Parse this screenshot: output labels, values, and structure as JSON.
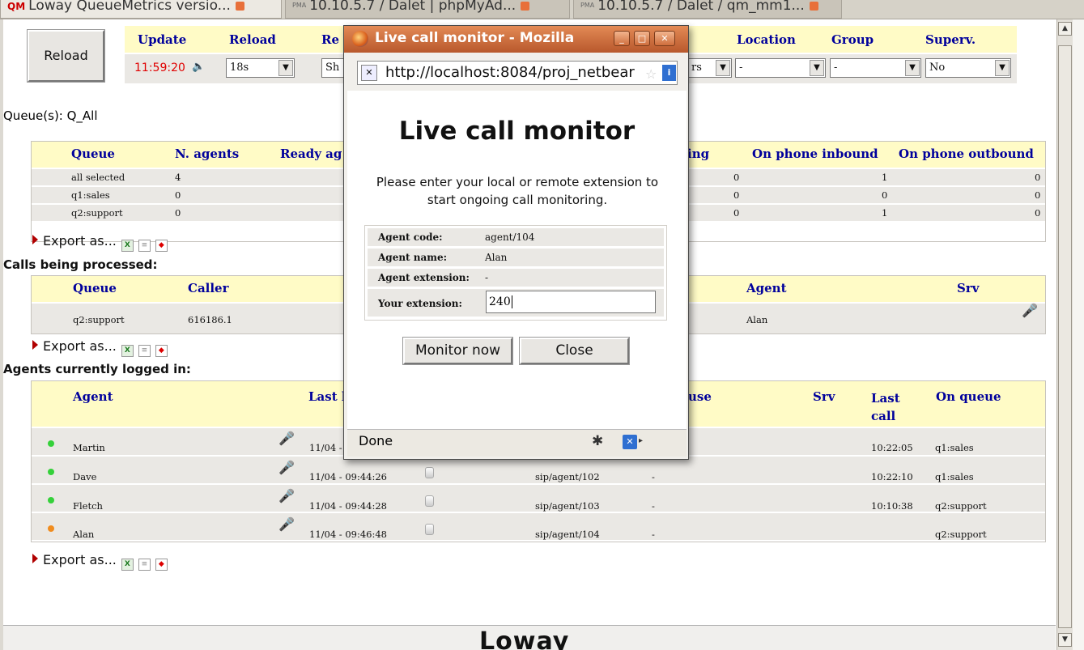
{
  "browser": {
    "tabs": [
      {
        "label": "Loway QueueMetrics versio...",
        "icon": "qm-logo"
      },
      {
        "label": "10.10.5.7 / Dalet | phpMyAd...",
        "icon": "pma-logo"
      },
      {
        "label": "10.10.5.7 / Dalet / qm_mm1...",
        "icon": "pma-logo"
      }
    ],
    "pma_text": "PMA"
  },
  "toolbar": {
    "reload_button": "Reload",
    "update_label": "Update",
    "update_time": "11:59:20",
    "reload_label": "Reload",
    "reload_interval": "18s",
    "re_label": "Re",
    "sh_value": "Sh",
    "rs_value": "rs",
    "location_label": "Location",
    "location_value": "-",
    "group_label": "Group",
    "group_value": "-",
    "superv_label": "Superv.",
    "superv_value": "No"
  },
  "queues_title": "Queue(s): Q_All",
  "queue_table": {
    "headers": [
      "Queue",
      "N. agents",
      "Ready ag",
      "ing",
      "On phone inbound",
      "On phone outbound"
    ],
    "rows": [
      {
        "queue": "all selected",
        "agents": "4",
        "ing": "0",
        "inbound": "1",
        "outbound": "0"
      },
      {
        "queue": "q1:sales",
        "agents": "0",
        "ing": "0",
        "inbound": "0",
        "outbound": "0"
      },
      {
        "queue": "q2:support",
        "agents": "0",
        "ing": "0",
        "inbound": "1",
        "outbound": "0"
      }
    ]
  },
  "export_label": "Export as...",
  "export_icons": {
    "xls": "X",
    "doc": "≡",
    "pdf": "◆"
  },
  "calls_title": "Calls being processed:",
  "calls_table": {
    "headers": [
      "Queue",
      "Caller",
      "Agent",
      "Srv"
    ],
    "rows": [
      {
        "queue": "q2:support",
        "caller": "616186.1",
        "agent": "Alan"
      }
    ]
  },
  "agents_title": "Agents currently logged in:",
  "agents_table": {
    "headers": [
      "Agent",
      "Last l",
      "use",
      "Srv",
      "Last call",
      "On queue"
    ],
    "last_call_line1": "Last",
    "last_call_line2": "call",
    "rows": [
      {
        "status_color": "#35d13a",
        "agent": "Martin",
        "logon": "11/04 -",
        "ext": "",
        "last_call": "10:22:05",
        "queue": "q1:sales"
      },
      {
        "status_color": "#35d13a",
        "agent": "Dave",
        "logon": "11/04 - 09:44:26",
        "ext": "sip/agent/102",
        "pause": "-",
        "last_call": "10:22:10",
        "queue": "q1:sales"
      },
      {
        "status_color": "#35d13a",
        "agent": "Fletch",
        "logon": "11/04 - 09:44:28",
        "ext": "sip/agent/103",
        "pause": "-",
        "last_call": "10:10:38",
        "queue": "q2:support"
      },
      {
        "status_color": "#f08c1e",
        "agent": "Alan",
        "logon": "11/04 - 09:46:48",
        "ext": "sip/agent/104",
        "pause": "-",
        "last_call": "",
        "queue": "q2:support"
      }
    ]
  },
  "footer_brand": "Loway",
  "popup": {
    "title": "Live call monitor - Mozilla",
    "url": "http://localhost:8084/proj_netbear",
    "heading": "Live call monitor",
    "instructions": "Please enter your local or remote extension to start ongoing call monitoring.",
    "fields": {
      "agent_code_label": "Agent code:",
      "agent_code_value": "agent/104",
      "agent_name_label": "Agent name:",
      "agent_name_value": "Alan",
      "agent_ext_label": "Agent extension:",
      "agent_ext_value": "-",
      "your_ext_label": "Your extension:",
      "your_ext_value": "240"
    },
    "monitor_button": "Monitor now",
    "close_button": "Close",
    "status": "Done"
  },
  "colors": {
    "header_bg": "#fffbc6",
    "header_text": "#00009c",
    "time_red": "#e00000",
    "popup_title": "#c8663a"
  }
}
